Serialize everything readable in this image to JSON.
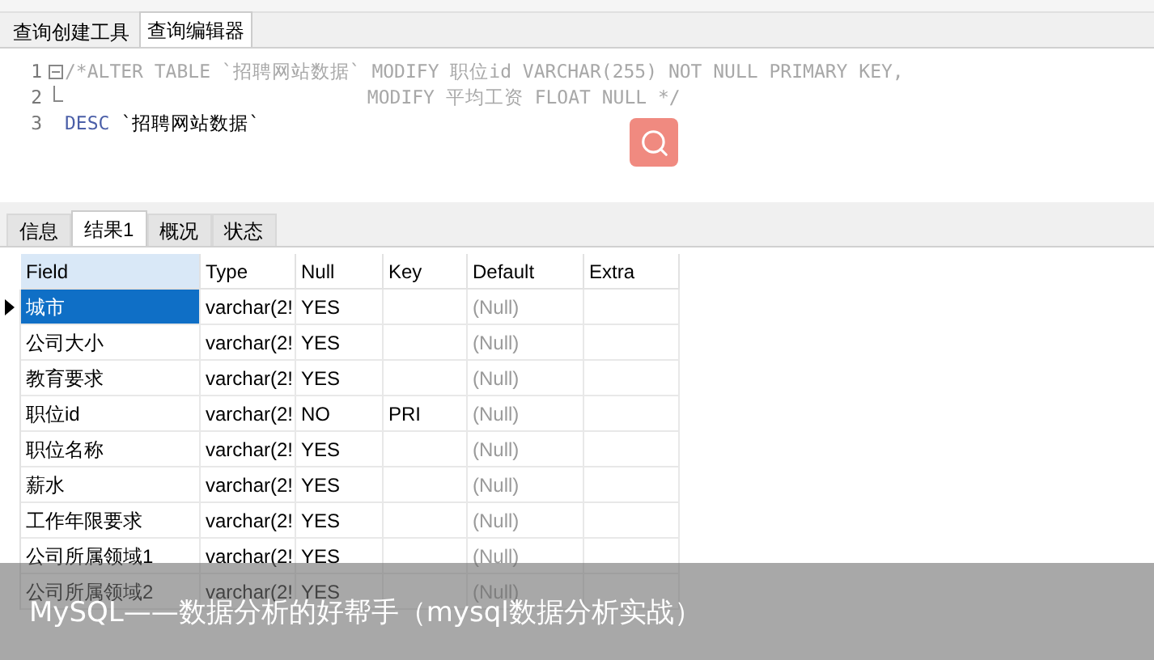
{
  "editor_tabs": [
    {
      "label": "查询创建工具",
      "selected": false
    },
    {
      "label": "查询编辑器",
      "selected": true
    }
  ],
  "editor": {
    "lines": [
      {
        "number": "1",
        "fold_open": true,
        "fold_end": false,
        "kind": "comment",
        "text": "/*ALTER TABLE `招聘网站数据` MODIFY 职位id VARCHAR(255) NOT NULL PRIMARY KEY,"
      },
      {
        "number": "2",
        "fold_open": false,
        "fold_end": true,
        "kind": "comment",
        "text": "                           MODIFY 平均工资 FLOAT NULL */"
      },
      {
        "number": "3",
        "kind": "code",
        "keyword": "DESC",
        "text": "`招聘网站数据`"
      }
    ]
  },
  "result_tabs": [
    {
      "label": "信息",
      "selected": false
    },
    {
      "label": "结果1",
      "selected": true
    },
    {
      "label": "概况",
      "selected": false
    },
    {
      "label": "状态",
      "selected": false
    }
  ],
  "table": {
    "columns": [
      "Field",
      "Type",
      "Null",
      "Key",
      "Default",
      "Extra"
    ],
    "rows": [
      {
        "selected": true,
        "cells": [
          "城市",
          "varchar(2!",
          "YES",
          "",
          "(Null)",
          ""
        ]
      },
      {
        "selected": false,
        "cells": [
          "公司大小",
          "varchar(2!",
          "YES",
          "",
          "(Null)",
          ""
        ]
      },
      {
        "selected": false,
        "cells": [
          "教育要求",
          "varchar(2!",
          "YES",
          "",
          "(Null)",
          ""
        ]
      },
      {
        "selected": false,
        "cells": [
          "职位id",
          "varchar(2!",
          "NO",
          "PRI",
          "(Null)",
          ""
        ]
      },
      {
        "selected": false,
        "cells": [
          "职位名称",
          "varchar(2!",
          "YES",
          "",
          "(Null)",
          ""
        ]
      },
      {
        "selected": false,
        "cells": [
          "薪水",
          "varchar(2!",
          "YES",
          "",
          "(Null)",
          ""
        ]
      },
      {
        "selected": false,
        "cells": [
          "工作年限要求",
          "varchar(2!",
          "YES",
          "",
          "(Null)",
          ""
        ]
      },
      {
        "selected": false,
        "cells": [
          "公司所属领域1",
          "varchar(2!",
          "YES",
          "",
          "(Null)",
          ""
        ]
      },
      {
        "selected": false,
        "cells": [
          "公司所属领域2",
          "varchar(2!",
          "YES",
          "",
          "(Null)",
          ""
        ]
      }
    ]
  },
  "caption": "MySQL——数据分析的好帮手（mysql数据分析实战）"
}
